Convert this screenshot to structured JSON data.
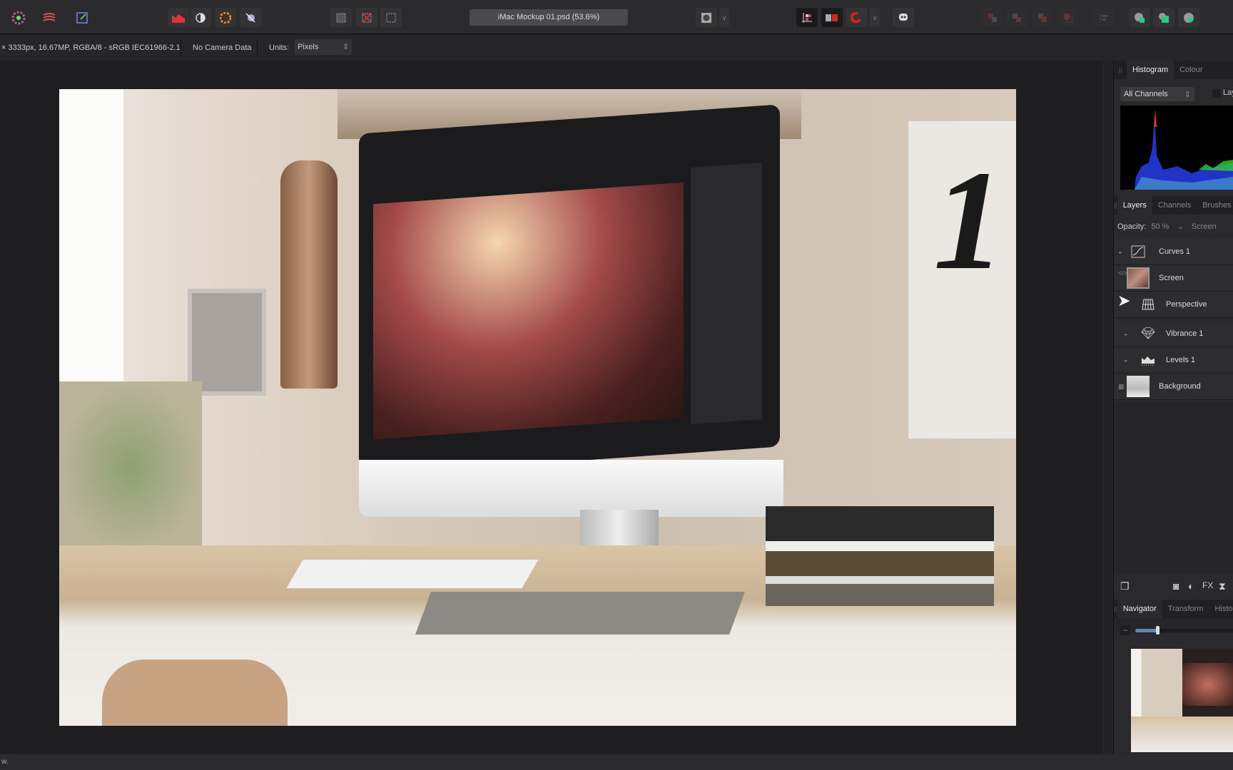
{
  "toolbar": {
    "left_icons": [
      "persona-photo-icon",
      "persona-liquify-icon",
      "persona-export-icon"
    ],
    "adjust_icons": [
      "auto-levels-icon",
      "auto-contrast-icon",
      "auto-colour-icon",
      "auto-white-balance-icon"
    ],
    "selection_icons": [
      "select-all-icon",
      "deselect-icon",
      "invert-selection-icon"
    ],
    "document_title": "iMac Mockup 01.psd (53.6%)",
    "right_icons": [
      "quick-mask-icon",
      "snapping-icon",
      "mirror-icon",
      "assistant-icon",
      "arrange-icons",
      "boolean-icons"
    ]
  },
  "context": {
    "image_info": "× 3333px, 16.67MP, RGBA/8 - sRGB IEC61966-2.1",
    "camera": "No Camera Data",
    "units_label": "Units:",
    "units_value": "Pixels"
  },
  "panels": {
    "histogram_tabs": [
      "Histogram",
      "Colour"
    ],
    "channels_select": "All Channels",
    "layers_checkbox_label": "Lay",
    "layers_tabs": [
      "Layers",
      "Channels",
      "Brushes"
    ],
    "opacity_label": "Opacity:",
    "opacity_value": "50 %",
    "blend_mode": "Screen",
    "layers": [
      {
        "name": "Curves 1",
        "icon": "curves-icon"
      },
      {
        "name": "Screen",
        "icon": "image-thumbnail"
      },
      {
        "name": "Perspective",
        "icon": "perspective-grid-icon"
      },
      {
        "name": "Vibrance 1",
        "icon": "diamond-icon"
      },
      {
        "name": "Levels 1",
        "icon": "levels-icon"
      },
      {
        "name": "Background",
        "icon": "image-thumbnail"
      }
    ],
    "navigator_tabs": [
      "Navigator",
      "Transform",
      "Histo"
    ]
  },
  "status": {
    "text": "w."
  }
}
